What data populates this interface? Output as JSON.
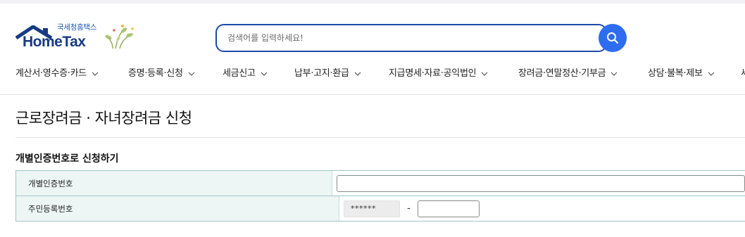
{
  "brand": {
    "sub_title": "국세청홈택스",
    "name": "HomeTax",
    "house_color": "#173a85"
  },
  "search": {
    "placeholder": "검색어를 입력하세요!",
    "value": "",
    "button_color": "#2e6cf0",
    "icon": "search-icon"
  },
  "nav": {
    "items": [
      {
        "label": "계산서·영수증·카드",
        "icon": "chevron-down-icon"
      },
      {
        "label": "증명·등록·신청",
        "icon": "chevron-down-icon"
      },
      {
        "label": "세금신고",
        "icon": "chevron-down-icon"
      },
      {
        "label": "납부·고지·환급",
        "icon": "chevron-down-icon"
      },
      {
        "label": "지급명세·자료·공익법인",
        "icon": "chevron-down-icon"
      },
      {
        "label": "장려금·연말정산·기부금",
        "icon": "chevron-down-icon"
      },
      {
        "label": "상담·불복·제보",
        "icon": "chevron-down-icon"
      },
      {
        "label": "세",
        "icon": ""
      }
    ]
  },
  "page": {
    "title": "근로장려금 · 자녀장려금 신청",
    "section_title": "개별인증번호로 신청하기"
  },
  "form": {
    "rows": [
      {
        "label": "개별인증번호",
        "value": ""
      },
      {
        "label": "주민등록번호",
        "masked_value": "******",
        "separator": "-",
        "value": ""
      }
    ],
    "border_color": "#9fc6c3",
    "label_bg": "#edf6f5"
  }
}
